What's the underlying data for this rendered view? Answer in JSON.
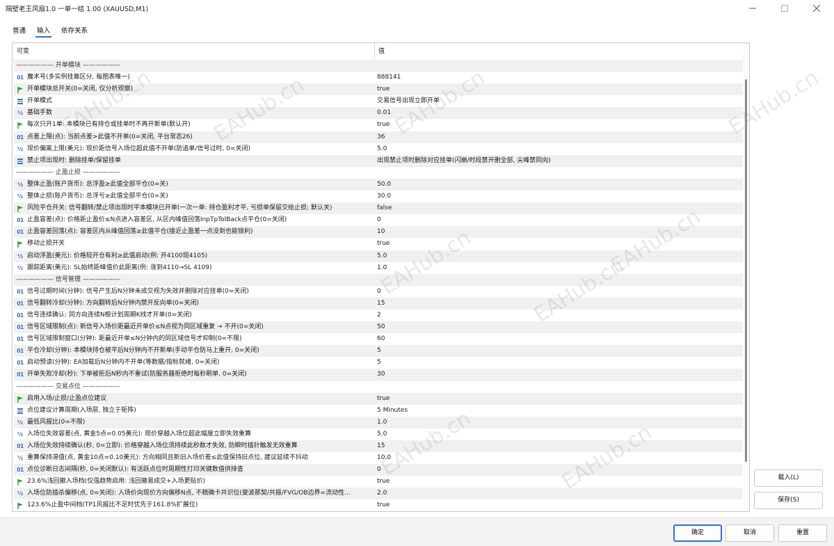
{
  "window": {
    "title": "隔壁老王风扇1.0 一单一结 1.00 (XAUUSD,M1)",
    "minimize_icon": "minimize-icon",
    "maximize_icon": "maximize-icon",
    "close_icon": "close-icon"
  },
  "tabs": [
    {
      "label": "普通",
      "active": false
    },
    {
      "label": "输入",
      "active": true
    },
    {
      "label": "依存关系",
      "active": false
    }
  ],
  "table": {
    "col_variable": "可变",
    "col_value": "值",
    "rows": [
      {
        "type": "section",
        "label": "—————— 开单模块 ——————",
        "value": ""
      },
      {
        "type": "int",
        "label": "魔术号(多实例挂靠区分, 每图表唯一)",
        "value": "888141"
      },
      {
        "type": "bool",
        "label": "开单模块总开关(0=关闭, 仅分析观察)",
        "value": "true"
      },
      {
        "type": "enum",
        "label": "开单模式",
        "value": "交易信号出现立即开单"
      },
      {
        "type": "double",
        "label": "基础手数",
        "value": "0.01"
      },
      {
        "type": "bool",
        "label": "每次只开1单: 本模块已有持仓或挂单时不再开新单(默认开)",
        "value": "true"
      },
      {
        "type": "int",
        "label": "点差上限(点): 当前点差>此值不开单(0=关闭, 平台常态26)",
        "value": "36"
      },
      {
        "type": "double",
        "label": "现价偏离上限(美元): 现价距信号入场位超此值不开单(防追单/信号过时, 0=关闭)",
        "value": "5.0"
      },
      {
        "type": "enum",
        "label": "禁止项出现时: 删除挂单/保留挂单",
        "value": "出现禁止项时删除对应挂单(闪崩/时段禁开删全部, 尖峰禁同向)"
      },
      {
        "type": "section",
        "label": "—————— 止盈止损 ——————",
        "value": ""
      },
      {
        "type": "double",
        "label": "整体止盈(账户货币): 总浮盈≥此值全部平仓(0=关)",
        "value": "50.0"
      },
      {
        "type": "double",
        "label": "整体止损(账户货币): 总浮亏≥此值全部平仓(0=关)",
        "value": "30.0"
      },
      {
        "type": "bool",
        "label": "风险平仓开关: 信号翻转/禁止项出现时平本模块已开单(一次一单: 持仓盈利才平, 亏损单保留交给止损; 默认关)",
        "value": "false"
      },
      {
        "type": "int",
        "label": "止盈容差(点): 价格距止盈价≤N点进入容差区, 从区内峰值回落InpTpTolBack点平仓(0=关闭)",
        "value": "0"
      },
      {
        "type": "int",
        "label": "止盈容差回落(点): 容差区内从峰值回落≥此值平仓(接近止盈差一点没到也能锁利)",
        "value": "10"
      },
      {
        "type": "bool",
        "label": "移动止损开关",
        "value": "true"
      },
      {
        "type": "double",
        "label": "启动浮盈(美元): 价格较开仓有利≥此值启动(例: 开4100现4105)",
        "value": "5.0"
      },
      {
        "type": "double",
        "label": "跟踪距离(美元): SL始终距峰值价此距离(例: 涨到4110→SL 4109)",
        "value": "1.0"
      },
      {
        "type": "section",
        "label": "—————— 信号管理 ——————",
        "value": ""
      },
      {
        "type": "int",
        "label": "信号过期时间(分钟): 信号产生后N分钟未成交视为失效并删除对应挂单(0=关闭)",
        "value": "0"
      },
      {
        "type": "int",
        "label": "信号翻转冷却(分钟): 方向翻转后N分钟内禁开反向单(0=关闭)",
        "value": "15"
      },
      {
        "type": "int",
        "label": "信号连续确认: 同方向连续N根计划周期K线才开单(0=关闭)",
        "value": "2"
      },
      {
        "type": "int",
        "label": "信号区域限制(点): 新信号入场价距最近开单价≤N点视为同区域重复 → 不开(0=关闭)",
        "value": "50"
      },
      {
        "type": "int",
        "label": "信号区域限制窗口(分钟): 距最近开单≤N分钟内的同区域信号才抑制(0=不限)",
        "value": "60"
      },
      {
        "type": "int",
        "label": "平仓冷却(分钟): 本模块持仓被平后N分钟内不开新单(手动平仓防马上重开, 0=关闭)",
        "value": "5"
      },
      {
        "type": "int",
        "label": "启动预读(分钟): EA加载后N分钟内不开单(等数据/指标就绪, 0=关闭)",
        "value": "5"
      },
      {
        "type": "int",
        "label": "开单失败冷却(秒): 下单被拒后N秒内不重试(防服务器拒绝时每秒刷单, 0=关闭)",
        "value": "30"
      },
      {
        "type": "section",
        "label": "—————— 交易点位 ——————",
        "value": ""
      },
      {
        "type": "bool",
        "label": "启用入场/止损/止盈点位建议",
        "value": "true"
      },
      {
        "type": "enum",
        "label": "点位建议计算周期(入场层, 独立于矩阵)",
        "value": "5 Minutes"
      },
      {
        "type": "double",
        "label": "最低风报比(0=不限)",
        "value": "1.0"
      },
      {
        "type": "double",
        "label": "入场位失效容差(点, 黄金5点=0.05美元): 现价穿越入场位超此幅度立即失效重算",
        "value": "5.0"
      },
      {
        "type": "int",
        "label": "入场位失效持续确认(秒, 0=立即): 价格穿越入场位须持续此秒数才失效, 防瞬时插针触发无效重算",
        "value": "15"
      },
      {
        "type": "double",
        "label": "重算保持滞值(点, 黄金10点=0.10美元): 方向相同且新旧入场价差≤此值保持旧点位, 建议延续不抖动",
        "value": "10.0"
      },
      {
        "type": "int",
        "label": "点位诊断日志间隔(秒, 0=关闭默认): 有活跃点位时周期性打印关键数值供排查",
        "value": "0"
      },
      {
        "type": "bool",
        "label": "23.6%浅回撤入场档(仅强趋势启用: 浅回撤易成交+入场更贴价)",
        "value": "true"
      },
      {
        "type": "double",
        "label": "入场位防插杀偏移(点, 0=关闭): 入场价向现价方向偏移N点, 不精确卡共识位(斐波那契/共振/FVG/OB边界=流动性...",
        "value": "2.0"
      },
      {
        "type": "bool",
        "label": "123.6%止盈中间档(TP1风报比不足时优先于161.8%扩展位)",
        "value": "true"
      }
    ]
  },
  "side_buttons": {
    "load": "载入(L)",
    "save": "保存(S)"
  },
  "footer": {
    "ok": "确定",
    "cancel": "取消",
    "reset": "重置"
  },
  "watermarks": [
    "EAHub.cn",
    "EAHub.cn",
    "EAHub.cn",
    "EAHub.cn",
    "EAHub.cn",
    "EAHub.cn",
    "EAHub.cn",
    "EAHub.cn",
    "EAHub.cn"
  ],
  "colors": {
    "accent": "#2b6fd6",
    "alt_row": "#f0f0f0",
    "icon_blue": "#3a6fb8",
    "icon_green": "#2e9e3a"
  }
}
